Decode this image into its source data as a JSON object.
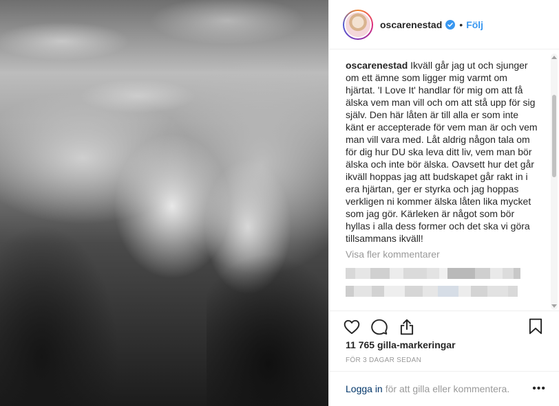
{
  "post": {
    "username": "oscarenestad",
    "follow_label": "Följ",
    "separator": "•",
    "caption": "Ikväll går jag ut och sjunger om ett ämne som ligger mig varmt om hjärtat. 'I Love It' handlar för mig om att få älska vem man vill och om att stå upp för sig själv. Den här låten är till alla er som inte känt er accepterade för vem man är och vem man vill vara med. Låt aldrig någon tala om för dig hur DU ska leva ditt liv, vem man bör älska och inte bör älska. Oavsett hur det går ikväll hoppas jag att budskapet går rakt in i era hjärtan, ger er styrka och jag hoppas verkligen ni kommer älska låten lika mycket som jag gör. Kärleken är något som bör hyllas i alla dess former och det ska vi göra tillsammans ikväll!",
    "view_more_comments": "Visa fler kommentarer",
    "likes": "11 765 gilla-markeringar",
    "time_ago": "FÖR 3 DAGAR SEDAN"
  },
  "footer": {
    "login_label": "Logga in",
    "login_text": "för att gilla eller kommentera.",
    "more_label": "•••"
  },
  "icons": {
    "verified": "verified-badge-icon",
    "like": "heart-icon",
    "comment": "comment-bubble-icon",
    "share": "share-icon",
    "save": "bookmark-icon"
  },
  "colors": {
    "link_blue": "#3897f0",
    "verified_blue": "#3897f0",
    "login_blue": "#003569",
    "muted": "#999999",
    "text": "#262626",
    "divider": "#efefef"
  }
}
